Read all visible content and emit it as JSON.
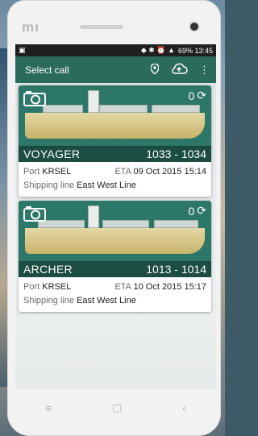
{
  "status_bar": {
    "right_text": "69%  13:45"
  },
  "appbar": {
    "title": "Select call"
  },
  "calls": [
    {
      "vessel": "VOYAGER",
      "voyage": "1033 - 1034",
      "photo_count": "0",
      "port_label": "Port",
      "port": "KRSEL",
      "eta_label": "ETA",
      "eta": "09 Oct 2015 15:14",
      "line_label": "Shipping line",
      "line": "East West Line"
    },
    {
      "vessel": "ARCHER",
      "voyage": "1013 - 1014",
      "photo_count": "0",
      "port_label": "Port",
      "port": "KRSEL",
      "eta_label": "ETA",
      "eta": "10 Oct 2015 15:17",
      "line_label": "Shipping line",
      "line": "East West Line"
    }
  ],
  "colors": {
    "appbar": "#2a6b5a",
    "card_image": "#2d7768",
    "status": "#1f1f1f"
  },
  "icons": [
    "map-pin-icon",
    "cloud-upload-icon",
    "overflow-menu-icon",
    "camera-icon",
    "refresh-icon"
  ]
}
